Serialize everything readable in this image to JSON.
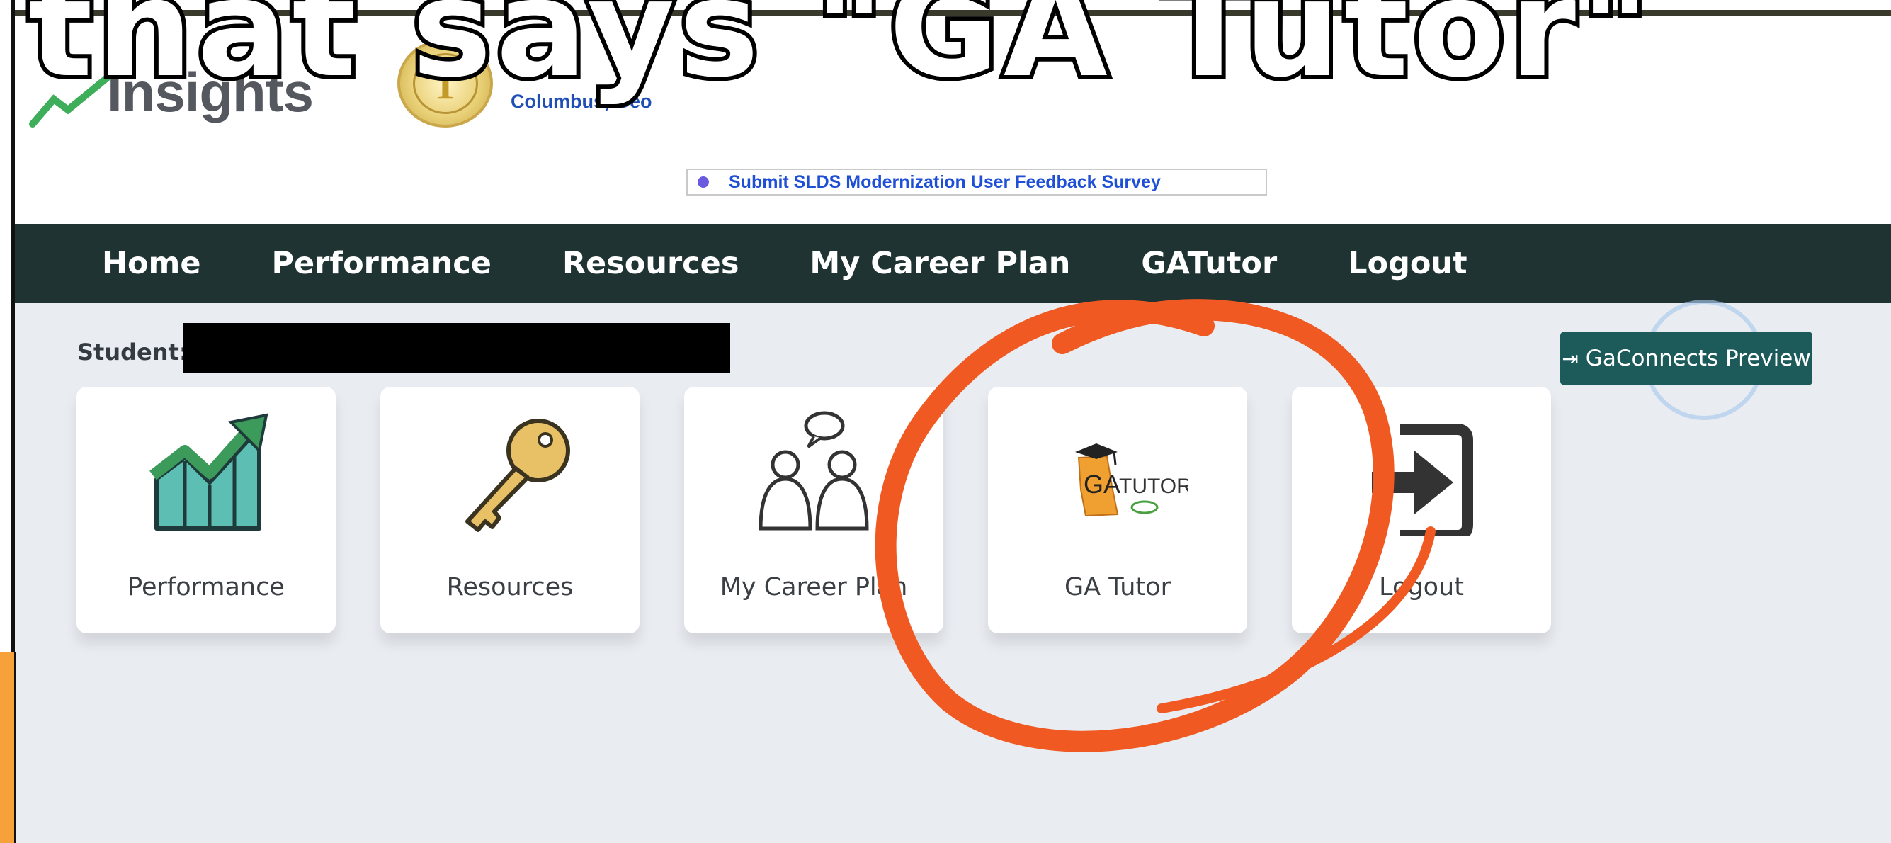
{
  "overlay_caption": "that says \"GA Tutor\"",
  "header": {
    "logo_word": "Insights",
    "city_text": "Columbus, Geo",
    "seal_letter": "T",
    "survey_link": "Submit SLDS Modernization User Feedback Survey"
  },
  "nav": {
    "items": [
      "Home",
      "Performance",
      "Resources",
      "My Career Plan",
      "GATutor",
      "Logout"
    ]
  },
  "main": {
    "student_label": "Student:",
    "gaconnects_label": "GaConnects Preview",
    "tiles": [
      {
        "label": "Performance",
        "icon": "chart-up-icon"
      },
      {
        "label": "Resources",
        "icon": "key-icon"
      },
      {
        "label": "My Career Plan",
        "icon": "people-chat-icon"
      },
      {
        "label": "GA Tutor",
        "icon": "ga-tutor-logo-icon"
      },
      {
        "label": "Logout",
        "icon": "logout-arrow-icon"
      }
    ]
  },
  "colors": {
    "nav_bg": "#1f3333",
    "page_bg": "#e9edf2",
    "gaconnects_bg": "#1d5b5b",
    "annotation_orange": "#f05a22",
    "survey_link": "#1e4fd6"
  }
}
